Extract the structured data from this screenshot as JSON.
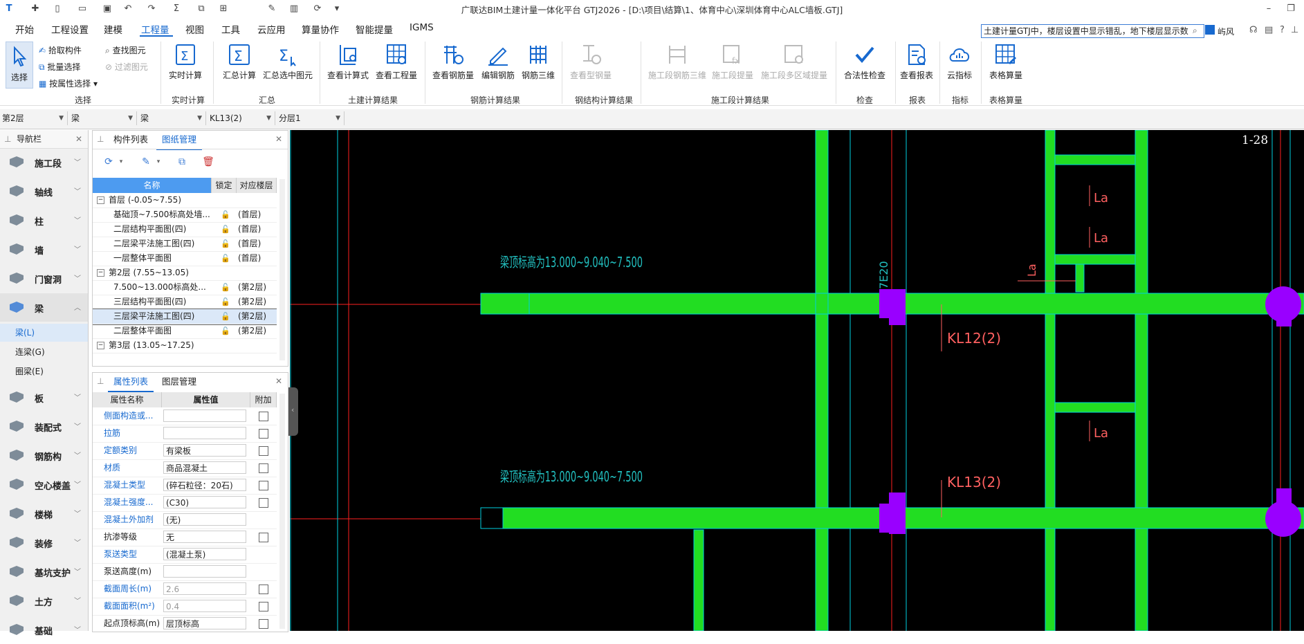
{
  "titlebar": {
    "title": "广联达BIM土建计量一体化平台 GTJ2026 - [D:\\项目\\结算\\1、体育中心\\深圳体育中心ALC墙板.GTJ]",
    "quick_icons": [
      "logo-icon",
      "new-icon",
      "file-icon",
      "open-icon",
      "save-icon",
      "undo-icon",
      "redo-icon",
      "sum-icon",
      "layer-icon",
      "grid-icon",
      "edit-icon",
      "column-icon",
      "refresh-icon",
      "more-icon"
    ],
    "window_buttons": [
      "minimize",
      "restore",
      "close"
    ]
  },
  "menu": {
    "items": [
      "开始",
      "工程设置",
      "建模",
      "工程量",
      "视图",
      "工具",
      "云应用",
      "算量协作",
      "智能提量",
      "IGMS"
    ],
    "active": "工程量",
    "search_text": "土建计量GTJ中，楼层设置中显示错乱，地下楼层显示数",
    "right_items": [
      "屿风"
    ]
  },
  "ribbon": {
    "groups": [
      {
        "label": "选择",
        "big": [
          {
            "label": "选择"
          }
        ],
        "small": [
          "拾取构件",
          "批量选择",
          "按属性选择",
          "查找图元",
          "过滤图元"
        ]
      },
      {
        "label": "实时计算",
        "big": [
          {
            "label": "实时计算"
          }
        ]
      },
      {
        "label": "汇总",
        "big": [
          {
            "label": "汇总计算"
          },
          {
            "label": "汇总选中图元"
          }
        ]
      },
      {
        "label": "土建计算结果",
        "big": [
          {
            "label": "查看计算式"
          },
          {
            "label": "查看工程量"
          }
        ]
      },
      {
        "label": "钢筋计算结果",
        "big": [
          {
            "label": "查看钢筋量"
          },
          {
            "label": "编辑钢筋"
          },
          {
            "label": "钢筋三维"
          }
        ]
      },
      {
        "label": "钢结构计算结果",
        "big": [
          {
            "label": "查看型钢量"
          }
        ]
      },
      {
        "label": "施工段计算结果",
        "big": [
          {
            "label": "施工段钢筋三维"
          },
          {
            "label": "施工段提量"
          },
          {
            "label": "施工段多区域提量"
          }
        ]
      },
      {
        "label": "检查",
        "big": [
          {
            "label": "合法性检查"
          }
        ]
      },
      {
        "label": "报表",
        "big": [
          {
            "label": "查看报表"
          }
        ]
      },
      {
        "label": "指标",
        "big": [
          {
            "label": "云指标"
          }
        ]
      },
      {
        "label": "表格算量",
        "big": [
          {
            "label": "表格算量"
          }
        ]
      }
    ]
  },
  "filters": [
    "第2层",
    "梁",
    "梁",
    "KL13(2)",
    "分层1"
  ],
  "nav": {
    "title": "导航栏",
    "items": [
      "施工段",
      "轴线",
      "柱",
      "墙",
      "门窗洞",
      "梁",
      "板",
      "装配式",
      "钢筋构",
      "空心楼盖",
      "楼梯",
      "装修",
      "基坑支护",
      "土方",
      "基础"
    ],
    "sub_items": [
      "梁(L)",
      "连梁(G)",
      "圈梁(E)"
    ],
    "active_item": "梁",
    "active_sub": "梁(L)"
  },
  "drawing_panel": {
    "tabs": [
      "构件列表",
      "图纸管理"
    ],
    "active_tab": "图纸管理",
    "columns": [
      "名称",
      "锁定",
      "对应楼层"
    ],
    "rows": [
      {
        "name": "首层 (-0.05~7.55)",
        "group": true,
        "floor": ""
      },
      {
        "name": "基础顶~7.500标高处墙...",
        "group": false,
        "floor": "(首层)"
      },
      {
        "name": "二层结构平面图(四)",
        "group": false,
        "floor": "(首层)"
      },
      {
        "name": "二层梁平法施工图(四)",
        "group": false,
        "floor": "(首层)"
      },
      {
        "name": "一层整体平面图",
        "group": false,
        "floor": "(首层)"
      },
      {
        "name": "第2层 (7.55~13.05)",
        "group": true,
        "floor": ""
      },
      {
        "name": "7.500~13.000标高处...",
        "group": false,
        "floor": "(第2层)"
      },
      {
        "name": "三层结构平面图(四)",
        "group": false,
        "floor": "(第2层)"
      },
      {
        "name": "三层梁平法施工图(四)",
        "group": false,
        "floor": "(第2层)",
        "selected": true
      },
      {
        "name": "二层整体平面图",
        "group": false,
        "floor": "(第2层)"
      },
      {
        "name": "第3层 (13.05~17.25)",
        "group": true,
        "floor": ""
      }
    ]
  },
  "prop_panel": {
    "tabs": [
      "属性列表",
      "图层管理"
    ],
    "active_tab": "属性列表",
    "columns": [
      "属性名称",
      "属性值",
      "附加"
    ],
    "rows": [
      {
        "name": "侧面构造或...",
        "value": "",
        "check": true,
        "blue": true
      },
      {
        "name": "拉筋",
        "value": "",
        "check": true,
        "blue": true
      },
      {
        "name": "定额类别",
        "value": "有梁板",
        "check": true,
        "blue": true
      },
      {
        "name": "材质",
        "value": "商品混凝土",
        "check": true,
        "blue": true
      },
      {
        "name": "混凝土类型",
        "value": "(碎石粒径：20石)",
        "check": true,
        "blue": true
      },
      {
        "name": "混凝土强度...",
        "value": "(C30)",
        "check": true,
        "blue": true
      },
      {
        "name": "混凝土外加剂",
        "value": "(无)",
        "check": false,
        "blue": true
      },
      {
        "name": "抗渗等级",
        "value": "无",
        "check": true,
        "blue": false
      },
      {
        "name": "泵送类型",
        "value": "(混凝土泵)",
        "check": false,
        "blue": true
      },
      {
        "name": "泵送高度(m)",
        "value": "",
        "check": false,
        "blue": false
      },
      {
        "name": "截面周长(m)",
        "value": "2.6",
        "check": true,
        "blue": true,
        "gray": true
      },
      {
        "name": "截面面积(m²)",
        "value": "0.4",
        "check": true,
        "blue": true,
        "gray": true
      },
      {
        "name": "起点顶标高(m)",
        "value": "层顶标高",
        "check": true,
        "blue": false
      }
    ]
  },
  "canvas": {
    "sheet_no": "1-28",
    "elevation_text_1": "梁顶标高为13.000~9.040~7.500",
    "elevation_text_2": "梁顶标高为13.000~9.040~7.500",
    "beam_label_1": "KL12(2)",
    "beam_label_2": "KL13(2)",
    "la_labels": [
      "La",
      "La",
      "La",
      "La"
    ],
    "dim_label": "7E20",
    "colors": {
      "background": "#000000",
      "beam": "#22dd22",
      "column": "#9900ff",
      "axis": "#ff2020",
      "outline": "#00d0e0",
      "text": "#22c0c0",
      "annotation": "#ff6060"
    }
  }
}
